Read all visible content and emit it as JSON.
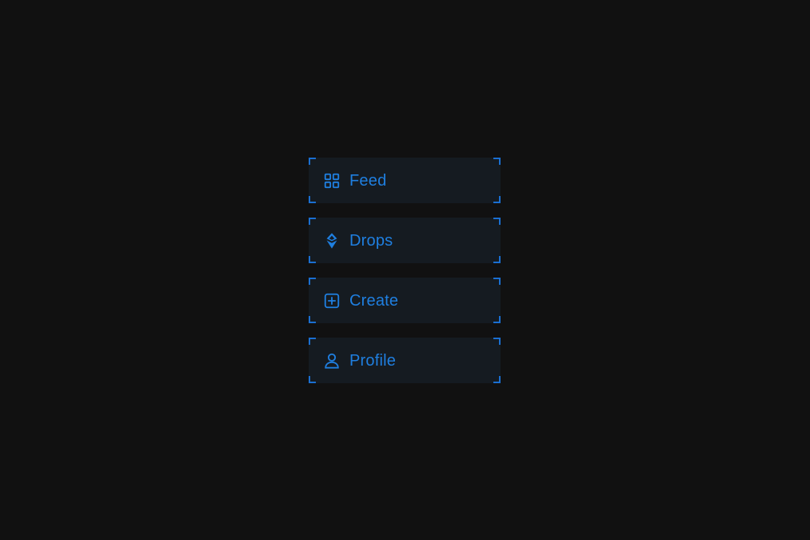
{
  "theme": {
    "accent": "#1f7fe0",
    "corner": "#1a6fd1",
    "item_background": "#151b21",
    "page_background": "#111111"
  },
  "menu": {
    "items": [
      {
        "label": "Feed",
        "icon": "grid-icon"
      },
      {
        "label": "Drops",
        "icon": "diamond-stack-icon"
      },
      {
        "label": "Create",
        "icon": "plus-square-icon"
      },
      {
        "label": "Profile",
        "icon": "user-icon"
      }
    ]
  }
}
